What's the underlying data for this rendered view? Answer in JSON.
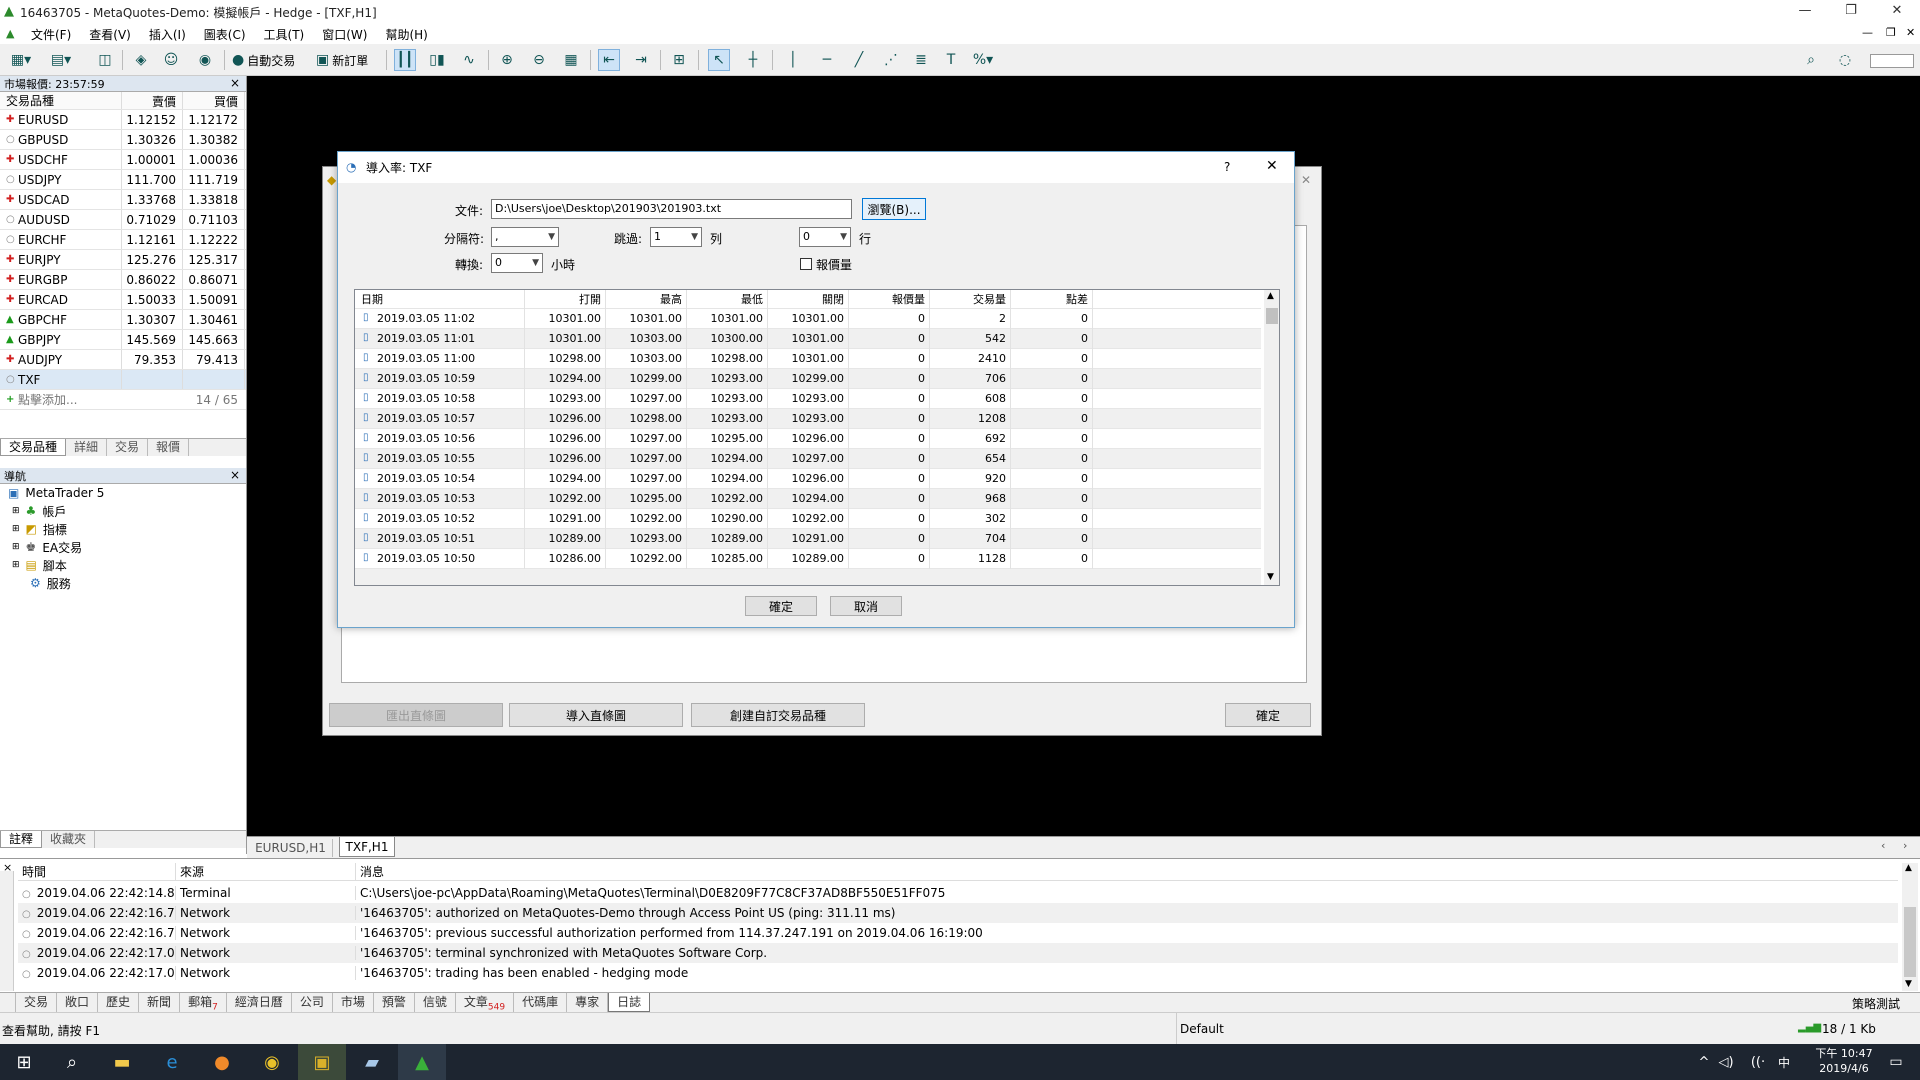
{
  "window": {
    "title": "16463705 - MetaQuotes-Demo: 模擬帳戶 - Hedge - [TXF,H1]"
  },
  "menu": [
    "文件(F)",
    "查看(V)",
    "插入(I)",
    "圖表(C)",
    "工具(T)",
    "窗口(W)",
    "幫助(H)"
  ],
  "toolbar": {
    "auto_trade": "自動交易",
    "new_order": "新訂單"
  },
  "market_watch": {
    "title": "市場報價: 23:57:59",
    "columns": [
      "交易品種",
      "賣價",
      "買價"
    ],
    "rows": [
      {
        "symbol": "EURUSD",
        "bid": "1.12152",
        "ask": "1.12172",
        "dir": "down"
      },
      {
        "symbol": "GBPUSD",
        "bid": "1.30326",
        "ask": "1.30382",
        "dir": "none"
      },
      {
        "symbol": "USDCHF",
        "bid": "1.00001",
        "ask": "1.00036",
        "dir": "down"
      },
      {
        "symbol": "USDJPY",
        "bid": "111.700",
        "ask": "111.719",
        "dir": "none"
      },
      {
        "symbol": "USDCAD",
        "bid": "1.33768",
        "ask": "1.33818",
        "dir": "down"
      },
      {
        "symbol": "AUDUSD",
        "bid": "0.71029",
        "ask": "0.71103",
        "dir": "none"
      },
      {
        "symbol": "EURCHF",
        "bid": "1.12161",
        "ask": "1.12222",
        "dir": "none"
      },
      {
        "symbol": "EURJPY",
        "bid": "125.276",
        "ask": "125.317",
        "dir": "down"
      },
      {
        "symbol": "EURGBP",
        "bid": "0.86022",
        "ask": "0.86071",
        "dir": "down"
      },
      {
        "symbol": "EURCAD",
        "bid": "1.50033",
        "ask": "1.50091",
        "dir": "down"
      },
      {
        "symbol": "GBPCHF",
        "bid": "1.30307",
        "ask": "1.30461",
        "dir": "up"
      },
      {
        "symbol": "GBPJPY",
        "bid": "145.569",
        "ask": "145.663",
        "dir": "up"
      },
      {
        "symbol": "AUDJPY",
        "bid": "79.353",
        "ask": "79.413",
        "dir": "down"
      },
      {
        "symbol": "TXF",
        "bid": "",
        "ask": "",
        "dir": "none"
      }
    ],
    "add_label": "點擊添加...",
    "count": "14 / 65",
    "tabs": [
      "交易品種",
      "詳細",
      "交易",
      "報價"
    ]
  },
  "navigator": {
    "title": "導航",
    "root": "MetaTrader 5",
    "items": [
      "帳戶",
      "指標",
      "EA交易",
      "腳本",
      "服務"
    ],
    "tabs": [
      "註釋",
      "收藏夾"
    ]
  },
  "chart_tabs": [
    "EURUSD,H1",
    "TXF,H1"
  ],
  "back_dialog": {
    "export_btn": "匯出直條圖",
    "import_btn": "導入直條圖",
    "create_btn": "創建自訂交易品種",
    "ok_btn": "確定"
  },
  "import_dialog": {
    "title": "導入率: TXF",
    "help": "?",
    "file_label": "文件:",
    "file_value": "D:\\Users\\joe\\Desktop\\201903\\201903.txt",
    "browse_btn": "瀏覽(B)...",
    "separator_label": "分隔符:",
    "separator_value": ",",
    "skip_label": "跳過:",
    "skip_rows_value": "1",
    "rows_unit": "列",
    "skip_lines_value": "0",
    "lines_unit": "行",
    "convert_label": "轉換:",
    "convert_value": "0",
    "hours_unit": "小時",
    "tick_volume_label": "報價量",
    "columns": [
      "日期",
      "打開",
      "最高",
      "最低",
      "關閉",
      "報價量",
      "交易量",
      "點差"
    ],
    "rows": [
      [
        "2019.03.05 11:02",
        "10301.00",
        "10301.00",
        "10301.00",
        "10301.00",
        "0",
        "2",
        "0"
      ],
      [
        "2019.03.05 11:01",
        "10301.00",
        "10303.00",
        "10300.00",
        "10301.00",
        "0",
        "542",
        "0"
      ],
      [
        "2019.03.05 11:00",
        "10298.00",
        "10303.00",
        "10298.00",
        "10301.00",
        "0",
        "2410",
        "0"
      ],
      [
        "2019.03.05 10:59",
        "10294.00",
        "10299.00",
        "10293.00",
        "10299.00",
        "0",
        "706",
        "0"
      ],
      [
        "2019.03.05 10:58",
        "10293.00",
        "10297.00",
        "10293.00",
        "10293.00",
        "0",
        "608",
        "0"
      ],
      [
        "2019.03.05 10:57",
        "10296.00",
        "10298.00",
        "10293.00",
        "10293.00",
        "0",
        "1208",
        "0"
      ],
      [
        "2019.03.05 10:56",
        "10296.00",
        "10297.00",
        "10295.00",
        "10296.00",
        "0",
        "692",
        "0"
      ],
      [
        "2019.03.05 10:55",
        "10296.00",
        "10297.00",
        "10294.00",
        "10297.00",
        "0",
        "654",
        "0"
      ],
      [
        "2019.03.05 10:54",
        "10294.00",
        "10297.00",
        "10294.00",
        "10296.00",
        "0",
        "920",
        "0"
      ],
      [
        "2019.03.05 10:53",
        "10292.00",
        "10295.00",
        "10292.00",
        "10294.00",
        "0",
        "968",
        "0"
      ],
      [
        "2019.03.05 10:52",
        "10291.00",
        "10292.00",
        "10290.00",
        "10292.00",
        "0",
        "302",
        "0"
      ],
      [
        "2019.03.05 10:51",
        "10289.00",
        "10293.00",
        "10289.00",
        "10291.00",
        "0",
        "704",
        "0"
      ],
      [
        "2019.03.05 10:50",
        "10286.00",
        "10292.00",
        "10285.00",
        "10289.00",
        "0",
        "1128",
        "0"
      ]
    ],
    "ok_btn": "確定",
    "cancel_btn": "取消"
  },
  "journal": {
    "columns": [
      "時間",
      "來源",
      "消息"
    ],
    "rows": [
      {
        "time": "2019.04.06 22:42:14.8...",
        "source": "Terminal",
        "msg": "C:\\Users\\joe-pc\\AppData\\Roaming\\MetaQuotes\\Terminal\\D0E8209F77C8CF37AD8BF550E51FF075"
      },
      {
        "time": "2019.04.06 22:42:16.7...",
        "source": "Network",
        "msg": "'16463705': authorized on MetaQuotes-Demo through Access Point US (ping: 311.11 ms)"
      },
      {
        "time": "2019.04.06 22:42:16.7...",
        "source": "Network",
        "msg": "'16463705': previous successful authorization performed from 114.37.247.191 on 2019.04.06 16:19:00"
      },
      {
        "time": "2019.04.06 22:42:17.0...",
        "source": "Network",
        "msg": "'16463705': terminal synchronized with MetaQuotes Software Corp."
      },
      {
        "time": "2019.04.06 22:42:17.0...",
        "source": "Network",
        "msg": "'16463705': trading has been enabled - hedging mode"
      }
    ]
  },
  "bottom_tabs": [
    "交易",
    "敞口",
    "歷史",
    "新聞",
    "郵箱",
    "經濟日曆",
    "公司",
    "市場",
    "預警",
    "信號",
    "文章",
    "代碼庫",
    "專家",
    "日誌"
  ],
  "bottom_tab_badges": {
    "mailbox": "7",
    "articles": "549"
  },
  "strategy_tester": "策略測試",
  "status": {
    "help": "查看幫助, 請按 F1",
    "profile": "Default",
    "traffic": "18 / 1 Kb"
  },
  "taskbar": {
    "time": "下午 10:47",
    "date": "2019/4/6",
    "ime": "中"
  },
  "colors": {
    "accent": "#2c6fb7",
    "down": "#d22020",
    "up": "#1a9a1a",
    "workspace": "#000000"
  }
}
